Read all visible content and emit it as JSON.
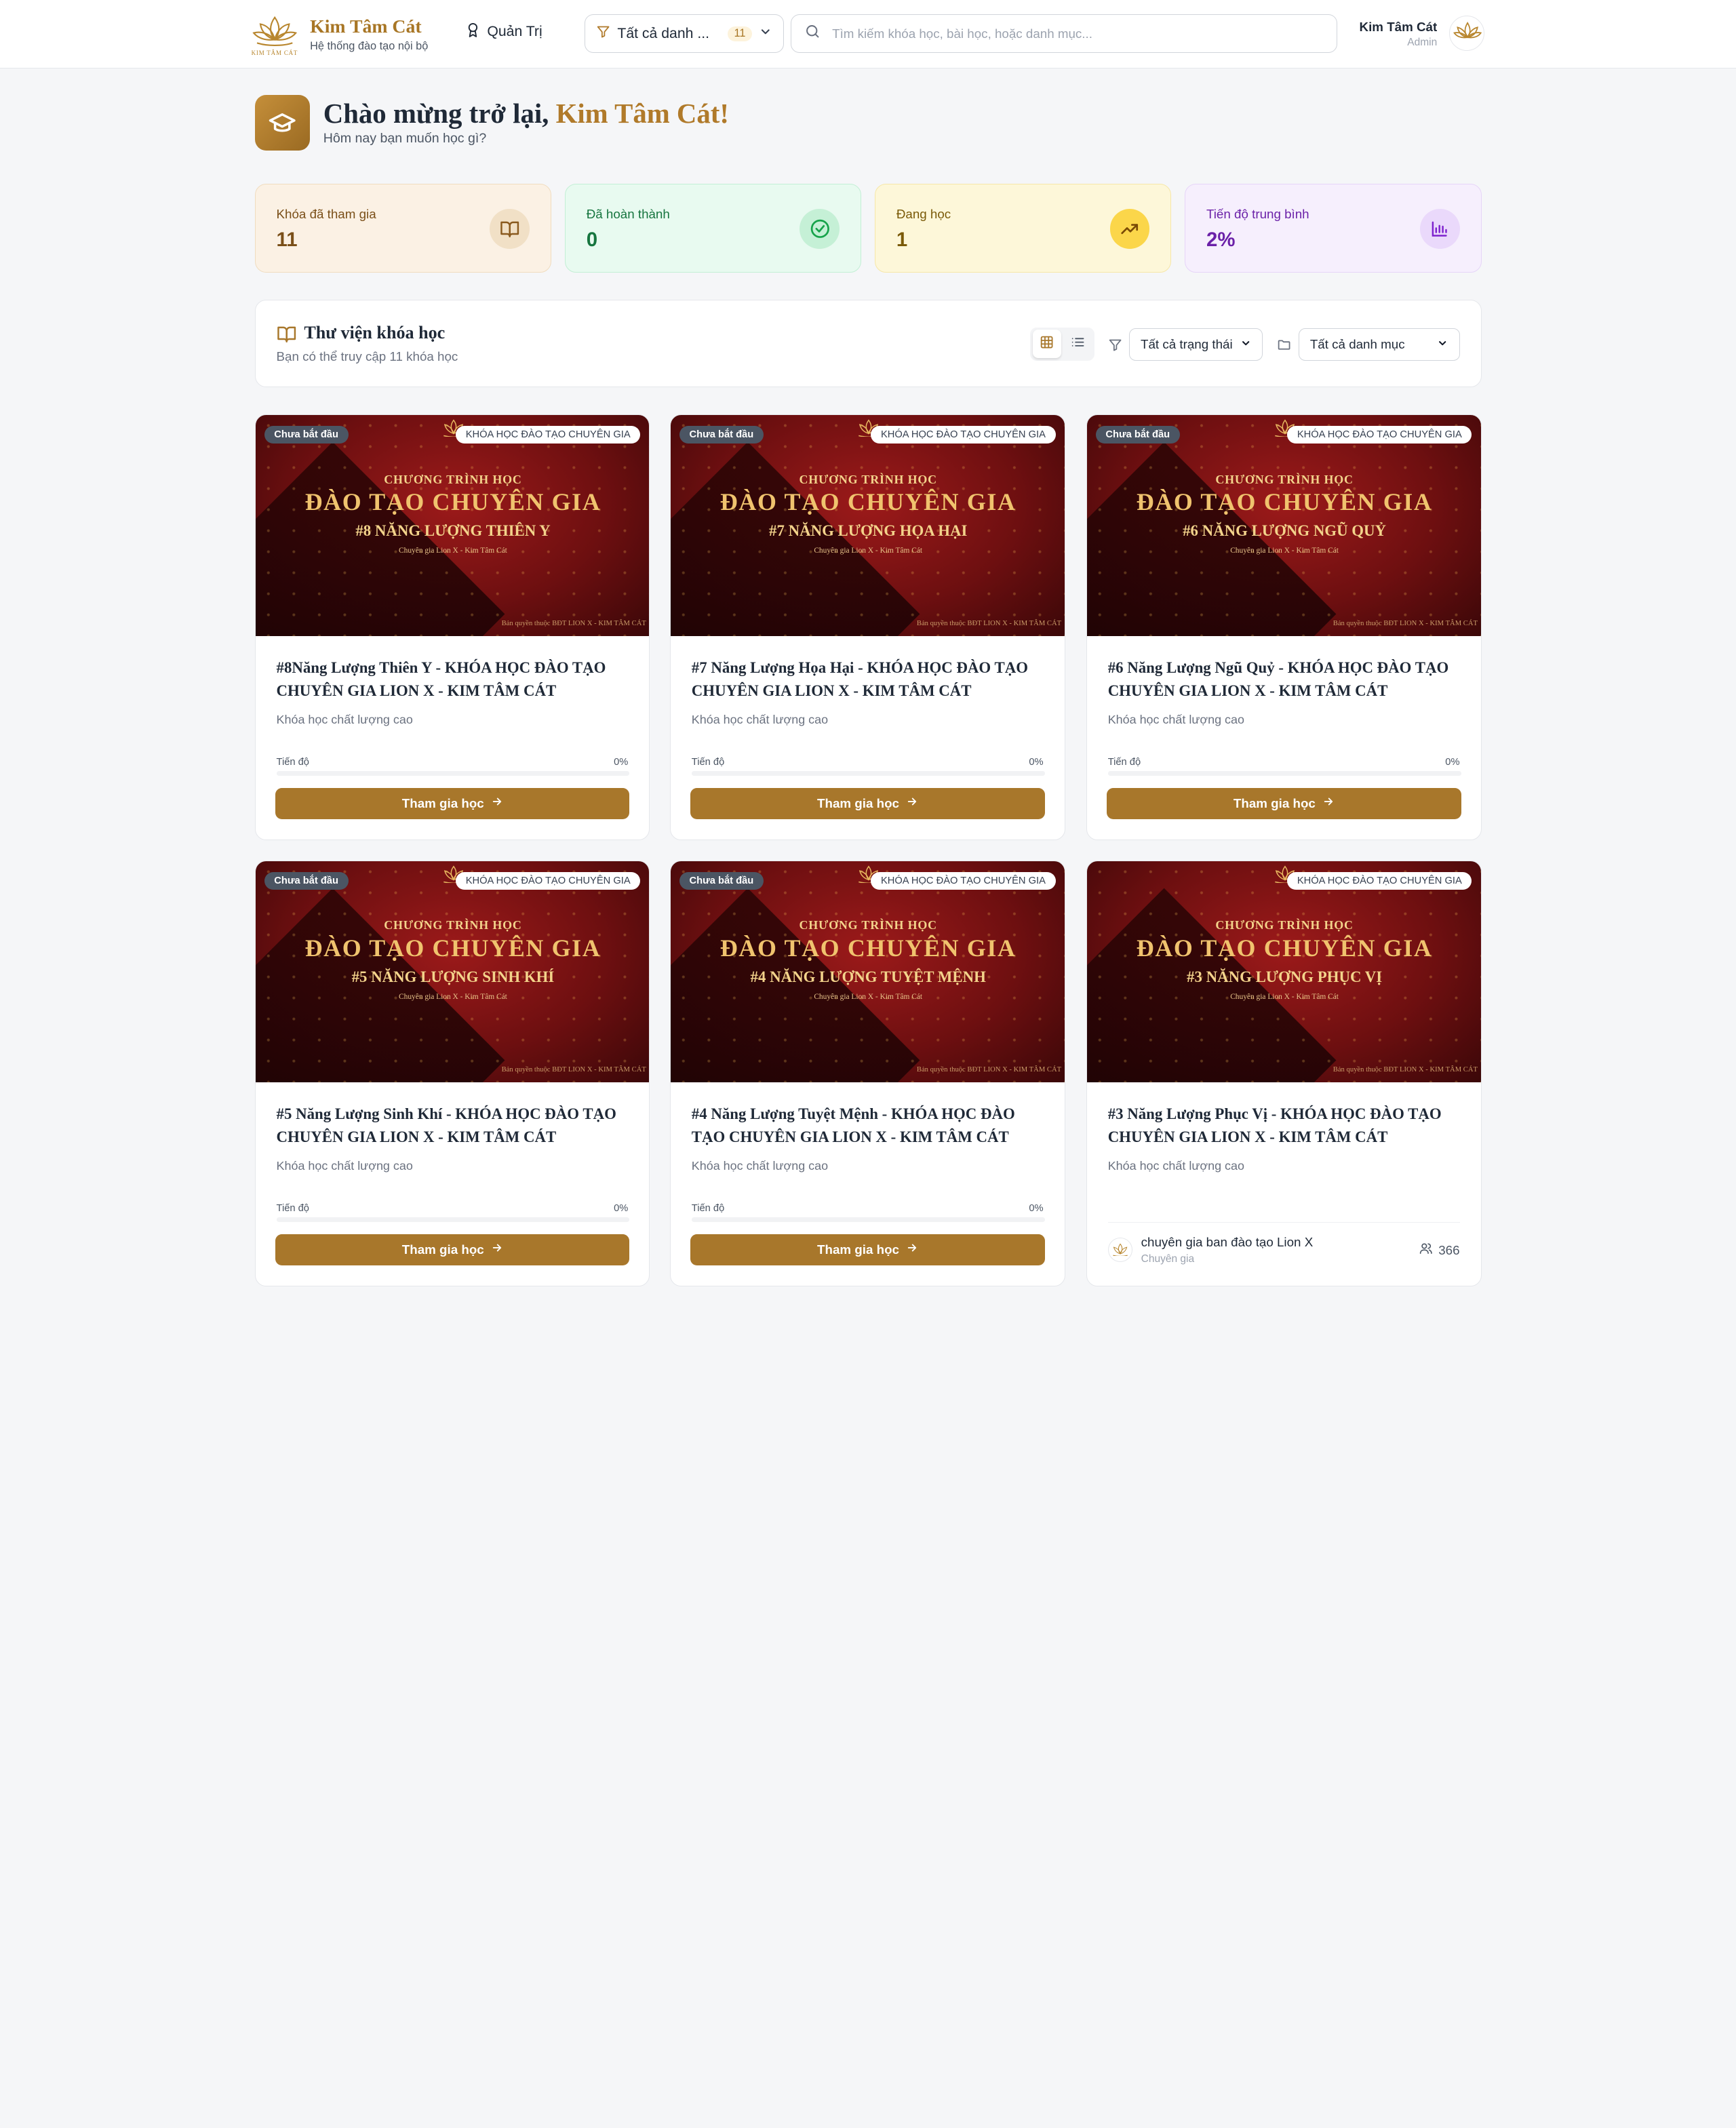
{
  "header": {
    "brand_title": "Kim Tâm Cát",
    "brand_subtitle": "Hệ thống đào tạo nội bộ",
    "logo_text": "KIM TÂM CÁT",
    "admin_link": "Quản Trị",
    "category_filter": {
      "label": "Tất cả danh ...",
      "count": "11"
    },
    "search_placeholder": "Tìm kiếm khóa học, bài học, hoặc danh mục...",
    "user": {
      "name": "Kim Tâm Cát",
      "role": "Admin"
    }
  },
  "welcome": {
    "greeting": "Chào mừng trở lại,",
    "name": "Kim Tâm Cát!",
    "subtitle": "Hôm nay bạn muốn học gì?"
  },
  "stats": [
    {
      "label": "Khóa đã tham gia",
      "value": "11",
      "icon": "book-open-icon",
      "bg": "#fbf1e4",
      "border": "#f0dcbf",
      "text": "#7a4f18",
      "icon_bg": "#f1e0c6",
      "icon_color": "#8a5a1f"
    },
    {
      "label": "Đã hoàn thành",
      "value": "0",
      "icon": "check-circle-icon",
      "bg": "#e8faf0",
      "border": "#c3efd5",
      "text": "#16753f",
      "icon_bg": "#c5f0d6",
      "icon_color": "#16a34a"
    },
    {
      "label": "Đang học",
      "value": "1",
      "icon": "trending-up-icon",
      "bg": "#fdf7d9",
      "border": "#f6e7a8",
      "text": "#7a5a08",
      "icon_bg": "#fbd64a",
      "icon_color": "#7a4a05"
    },
    {
      "label": "Tiến độ trung bình",
      "value": "2%",
      "icon": "bar-chart-icon",
      "bg": "#f6effd",
      "border": "#e6d5f8",
      "text": "#6b21a8",
      "icon_bg": "#ead9fb",
      "icon_color": "#7e22ce"
    }
  ],
  "library": {
    "title": "Thư viện khóa học",
    "subtitle": "Bạn có thể truy cập 11 khóa học",
    "status_filter": "Tất cả trạng thái",
    "category_filter": "Tất cả danh mục"
  },
  "banner": {
    "pre": "CHƯƠNG TRÌNH HỌC",
    "main": "ĐÀO TẠO CHUYÊN GIA",
    "tiny": "Chuyên gia Lion X - Kim Tâm Cát",
    "copyright": "Bản quyền thuộc BĐT LION X - KIM TÂM CÁT"
  },
  "courses": [
    {
      "status": "Chưa bắt đầu",
      "category": "KHÓA HỌC ĐÀO TẠO CHUYÊN GIA",
      "banner_sub": "#8 NĂNG LƯỢNG THIÊN Y",
      "title": "#8Năng Lượng Thiên Y - KHÓA HỌC ĐÀO TẠO CHUYÊN GIA LION X - KIM TÂM CÁT",
      "description": "Khóa học chất lượng cao",
      "progress_label": "Tiến độ",
      "progress": "0%",
      "progress_value": 0,
      "button": "Tham gia học"
    },
    {
      "status": "Chưa bắt đầu",
      "category": "KHÓA HỌC ĐÀO TẠO CHUYÊN GIA",
      "banner_sub": "#7 NĂNG LƯỢNG HỌA HẠI",
      "title": "#7 Năng Lượng Họa Hại - KHÓA HỌC ĐÀO TẠO CHUYÊN GIA LION X - KIM TÂM CÁT",
      "description": "Khóa học chất lượng cao",
      "progress_label": "Tiến độ",
      "progress": "0%",
      "progress_value": 0,
      "button": "Tham gia học"
    },
    {
      "status": "Chưa bắt đầu",
      "category": "KHÓA HỌC ĐÀO TẠO CHUYÊN GIA",
      "banner_sub": "#6 NĂNG LƯỢNG NGŨ QUỶ",
      "title": "#6 Năng Lượng Ngũ Quỷ - KHÓA HỌC ĐÀO TẠO CHUYÊN GIA LION X - KIM TÂM CÁT",
      "description": "Khóa học chất lượng cao",
      "progress_label": "Tiến độ",
      "progress": "0%",
      "progress_value": 0,
      "button": "Tham gia học"
    },
    {
      "status": "Chưa bắt đầu",
      "category": "KHÓA HỌC ĐÀO TẠO CHUYÊN GIA",
      "banner_sub": "#5 NĂNG LƯỢNG SINH KHÍ",
      "title": "#5 Năng Lượng Sinh Khí - KHÓA HỌC ĐÀO TẠO CHUYÊN GIA LION X - KIM TÂM CÁT",
      "description": "Khóa học chất lượng cao",
      "progress_label": "Tiến độ",
      "progress": "0%",
      "progress_value": 0,
      "button": "Tham gia học"
    },
    {
      "status": "Chưa bắt đầu",
      "category": "KHÓA HỌC ĐÀO TẠO CHUYÊN GIA",
      "banner_sub": "#4 NĂNG LƯỢNG TUYỆT MỆNH",
      "title": "#4 Năng Lượng Tuyệt Mệnh - KHÓA HỌC ĐÀO TẠO CHUYÊN GIA LION X - KIM TÂM CÁT",
      "description": "Khóa học chất lượng cao",
      "progress_label": "Tiến độ",
      "progress": "0%",
      "progress_value": 0,
      "button": "Tham gia học"
    },
    {
      "category": "KHÓA HỌC ĐÀO TẠO CHUYÊN GIA",
      "banner_sub": "#3 NĂNG LƯỢNG PHỤC VỊ",
      "title": "#3 Năng Lượng Phục Vị - KHÓA HỌC ĐÀO TẠO CHUYÊN GIA LION X - KIM TÂM CÁT",
      "description": "Khóa học chất lượng cao",
      "instructor": "chuyên gia ban đào tạo Lion X",
      "instructor_role": "Chuyên gia",
      "students": "366"
    }
  ],
  "colors": {
    "accent": "#a8772b",
    "brand": "#b07a2a",
    "banner_red": "#7a1214"
  }
}
